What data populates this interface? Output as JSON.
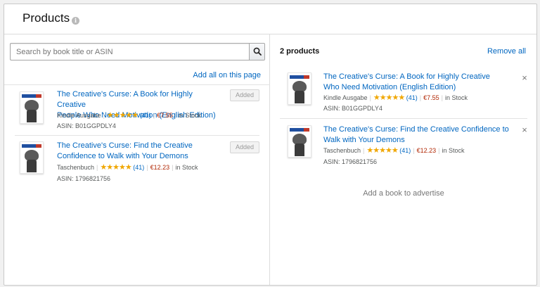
{
  "header": {
    "title": "Products",
    "info_icon": "info-icon"
  },
  "search": {
    "placeholder": "Search by book title or ASIN",
    "value": "",
    "button_icon": "search-icon"
  },
  "left": {
    "add_all_label": "Add all on this page",
    "results": [
      {
        "title_line1": "The Creative's Curse: A Book for Highly Creative",
        "title_line2": "People Who Need Motivation (English Edition)",
        "format": "Kindle Ausgabe",
        "stars": "★★★★★",
        "rating_count": "(41)",
        "price": "€7.55",
        "stock": "in Stock",
        "asin": "ASIN: B01GGPDLY4",
        "button_label": "Added"
      },
      {
        "title_line1": "The Creative's Curse: Find the Creative",
        "title_line2": "Confidence to Walk with Your Demons",
        "format": "Taschenbuch",
        "stars": "★★★★★",
        "rating_count": "(41)",
        "price": "€12.23",
        "stock": "in Stock",
        "asin": "ASIN: 1796821756",
        "button_label": "Added"
      }
    ]
  },
  "right": {
    "count_label": "2 products",
    "remove_all_label": "Remove all",
    "selected": [
      {
        "title_line1": "The Creative's Curse: A Book for Highly Creative",
        "title_line2": "Who Need Motivation (English Edition)",
        "format": "Kindle Ausgabe",
        "stars": "★★★★★",
        "rating_count": "(41)",
        "price": "€7.55",
        "stock": "in Stock",
        "asin": "ASIN: B01GGPDLY4",
        "remove_glyph": "×"
      },
      {
        "title_line1": "The Creative's Curse: Find the Creative Confidence to",
        "title_line2": "Walk with Your Demons",
        "format": "Taschenbuch",
        "stars": "★★★★★",
        "rating_count": "(41)",
        "price": "€12.23",
        "stock": "in Stock",
        "asin": "ASIN: 1796821756",
        "remove_glyph": "×"
      }
    ],
    "add_book_label": "Add a book to advertise"
  },
  "colors": {
    "link": "#0066c0",
    "price": "#b12704",
    "stars": "#f0a700"
  }
}
